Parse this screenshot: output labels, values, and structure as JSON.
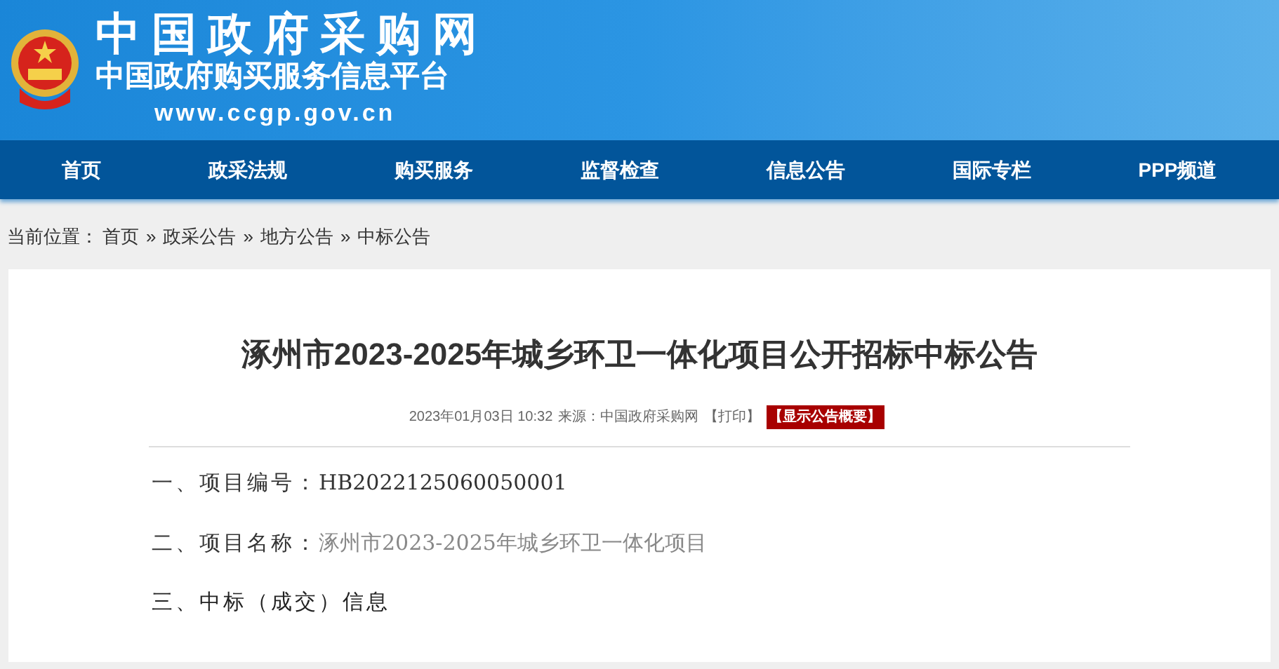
{
  "header": {
    "site_name": "中国政府采购网",
    "subtitle": "中国政府购买服务信息平台",
    "url": "www.ccgp.gov.cn"
  },
  "nav": [
    {
      "label": "首页"
    },
    {
      "label": "政采法规"
    },
    {
      "label": "购买服务"
    },
    {
      "label": "监督检查"
    },
    {
      "label": "信息公告"
    },
    {
      "label": "国际专栏"
    },
    {
      "label": "PPP频道"
    }
  ],
  "breadcrumb": {
    "label": "当前位置：",
    "items": [
      {
        "text": "首页",
        "separator": "»"
      },
      {
        "text": "政采公告",
        "separator": "»"
      },
      {
        "text": "地方公告",
        "separator": "»"
      },
      {
        "text": "中标公告"
      }
    ]
  },
  "article": {
    "title": "涿州市2023-2025年城乡环卫一体化项目公开招标中标公告",
    "meta": {
      "date": "2023年01月03日 10:32",
      "source": "来源：中国政府采购网",
      "print": "【打印】",
      "summary_button": "【显示公告概要】"
    },
    "sections": [
      {
        "heading": "一、项目编号：",
        "value": "HB2022125060050001",
        "kind": "plain"
      },
      {
        "heading": "二、项目名称：",
        "value": "涿州市2023-2025年城乡环卫一体化项目",
        "kind": "muted"
      },
      {
        "heading": "三、中标（成交）信息",
        "kind": "heading"
      }
    ]
  }
}
